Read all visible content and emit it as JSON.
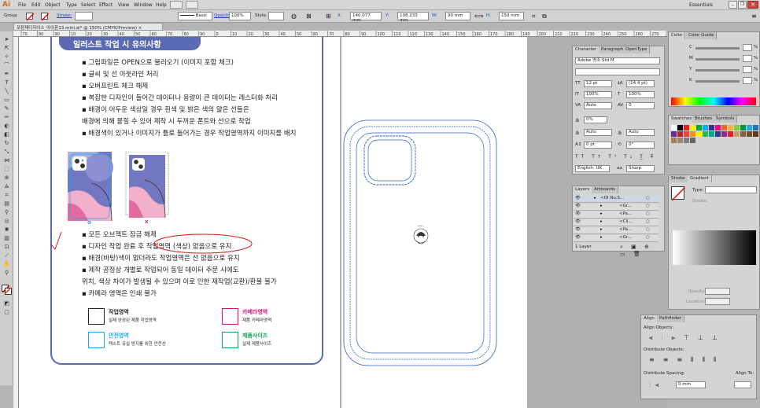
{
  "app": {
    "logo": "Ai",
    "workspace": "Essentials"
  },
  "menu": [
    "File",
    "Edit",
    "Object",
    "Type",
    "Select",
    "Effect",
    "View",
    "Window",
    "Help"
  ],
  "control": {
    "selection_label": "Group",
    "stroke_label": "Stroke:",
    "brush": "Basic",
    "opacity_label": "Opacity:",
    "opacity": "100%",
    "style_label": "Style:",
    "x_label": "X:",
    "x": "140.077 mm",
    "y_label": "Y:",
    "y": "108.233 mm",
    "w_label": "W:",
    "w": "90 mm",
    "h_label": "H:",
    "h": "150 mm"
  },
  "document": {
    "tab": "포장재디자이스_아이폰13 mini.ai* @ 150% (CMYK/Preview)"
  },
  "ruler_ticks": [
    "70",
    "80",
    "90",
    "10",
    "20",
    "30",
    "40",
    "50",
    "60",
    "70",
    "80",
    "90",
    "0",
    "10",
    "20",
    "30",
    "40",
    "50",
    "60",
    "70",
    "80",
    "90",
    "100",
    "110",
    "120",
    "130",
    "140",
    "150",
    "160",
    "170",
    "180",
    "190",
    "200",
    "210",
    "220",
    "230",
    "240",
    "250",
    "260",
    "270",
    "280"
  ],
  "guide": {
    "title": "일러스트 작업 시 유의사항",
    "rules": [
      "▪ 그림파일은 OPEN으로 불러오기 (이미지 포함 체크)",
      "▪ 글씨 및 선 아웃라인 처리",
      "▪ 오버프린트 체크 해제",
      "▪ 복잡한 디자인이 들어간 데이터나 용량이 큰 데이터는 레스터화 처리",
      "▪ 배경이 어두운 색상일 경우 흰색 및 밝은 색의 얇은 선들은",
      "   배경에 의해 묻힐 수 있어 제작 시 두꺼운 폰트와 선으로 작업",
      "▪ 배경색이 있거나 이미지가 틀로 들어가는 경우 작업영역까지 이미지를 배치"
    ],
    "good_mark": "o",
    "bad_mark": "x",
    "rules2": [
      "▪ 모든 오브젝트 잠금 해제",
      "▪ 디자인 작업 완료 후 작업영역 (색상) 없음으로 유지",
      "▪ 배경(바탕)색이 없더라도 작업영역은 선 없음으로 유지",
      "▪ 제작 공정상 개별로 작업되어 동일 데이터 주문 시에도",
      "   위치, 색상 차이가 발생될 수 있으며 이로 인한 재작업(교환)/환불 불가",
      "▪ 카메라 영역은 인쇄 불가"
    ],
    "legend": [
      {
        "title": "작업영역",
        "desc": "실제 완성된 제품 작업영역",
        "color": "#222222"
      },
      {
        "title": "카메라영역",
        "desc": "제품 카메라영역",
        "color": "#d6127a"
      },
      {
        "title": "안전영역",
        "desc": "텍스트 유실 방지를 위한 안전선",
        "color": "#1ea7e1"
      },
      {
        "title": "제품사이즈",
        "desc": "실제 제품사이즈",
        "color": "#13a055"
      }
    ]
  },
  "character_panel": {
    "tabs": [
      "Character",
      "Paragraph",
      "OpenType"
    ],
    "font": "Adobe 명조 Std M",
    "size": "12 pt",
    "leading": "(14.4 pt)",
    "hscale": "100%",
    "vscale": "100%",
    "kerning": "Auto",
    "tracking": "0",
    "tsume": "0%",
    "aki1": "Auto",
    "aki2": "Auto",
    "baseline": "0 pt",
    "rotate": "0°",
    "lang": "English: UK",
    "aa_label": "aa",
    "aa": "Sharp"
  },
  "color_panel": {
    "tabs": [
      "Color",
      "Color Guide"
    ],
    "channels": [
      "C",
      "M",
      "Y",
      "K"
    ],
    "unit": "%"
  },
  "swatches_panel": {
    "tabs": [
      "Swatches",
      "Brushes",
      "Symbols"
    ]
  },
  "gradient_panel": {
    "tabs": [
      "Stroke",
      "Gradient"
    ],
    "type_label": "Type:",
    "stroke_label": "Stroke:",
    "opacity_label": "Opacity:",
    "location_label": "Location:"
  },
  "layers_panel": {
    "tabs": [
      "Layers",
      "Artboards"
    ],
    "rows": [
      "<Ol Nu.S...",
      "<Gr...",
      "<Pa...",
      "<Cli...",
      "<Pa...",
      "<Gr..."
    ],
    "footer": "1 Layer"
  },
  "align_panel": {
    "tabs": [
      "Align",
      "Pathfinder"
    ],
    "objects": "Align Objects:",
    "distribute": "Distribute Objects:",
    "spacing": "Distribute Spacing:",
    "align_to": "Align To:",
    "spacing_value": "0 mm"
  }
}
